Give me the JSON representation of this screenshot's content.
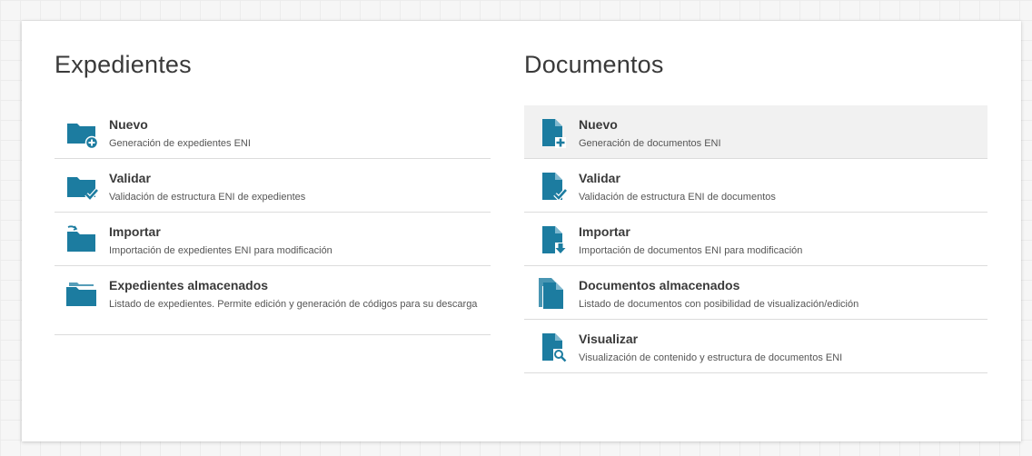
{
  "colors": {
    "accent": "#1c7ca0",
    "title": "#3a3a3a",
    "desc": "#555555",
    "divider": "#dcdcdc",
    "active_row": "#f1f1f1"
  },
  "expedientes": {
    "title": "Expedientes",
    "items": [
      {
        "title": "Nuevo",
        "desc": "Generación de expedientes ENI",
        "icon": "folder-plus-icon"
      },
      {
        "title": "Validar",
        "desc": "Validación de estructura ENI de expedientes",
        "icon": "folder-check-icon"
      },
      {
        "title": "Importar",
        "desc": "Importación de expedientes ENI para modificación",
        "icon": "folder-import-icon"
      },
      {
        "title": "Expedientes almacenados",
        "desc": "Listado de expedientes. Permite edición y generación de códigos para su descarga",
        "icon": "folders-stack-icon"
      }
    ]
  },
  "documentos": {
    "title": "Documentos",
    "items": [
      {
        "title": "Nuevo",
        "desc": "Generación de documentos ENI",
        "icon": "document-plus-icon"
      },
      {
        "title": "Validar",
        "desc": "Validación de estructura ENI de documentos",
        "icon": "document-check-icon"
      },
      {
        "title": "Importar",
        "desc": "Importación de documentos ENI para modificación",
        "icon": "document-import-icon"
      },
      {
        "title": "Documentos almacenados",
        "desc": "Listado de documentos con posibilidad de visualización/edición",
        "icon": "documents-stack-icon"
      },
      {
        "title": "Visualizar",
        "desc": "Visualización de contenido y estructura de documentos ENI",
        "icon": "document-search-icon"
      }
    ]
  }
}
